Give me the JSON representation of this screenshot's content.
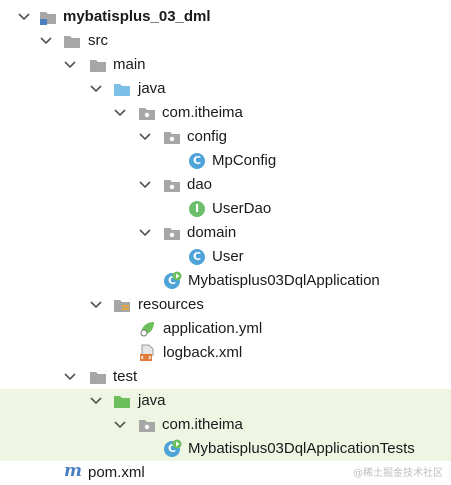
{
  "tree": {
    "items": [
      {
        "label": "mybatisplus_03_dml",
        "icon": "module-folder-icon",
        "expanded": true
      },
      {
        "label": "src",
        "icon": "folder-icon",
        "expanded": true
      },
      {
        "label": "main",
        "icon": "folder-icon",
        "expanded": true
      },
      {
        "label": "java",
        "icon": "source-root-folder-icon",
        "expanded": true
      },
      {
        "label": "com.itheima",
        "icon": "package-icon",
        "expanded": true
      },
      {
        "label": "config",
        "icon": "package-icon",
        "expanded": true
      },
      {
        "label": "MpConfig",
        "icon": "class-icon",
        "glyph": "C"
      },
      {
        "label": "dao",
        "icon": "package-icon",
        "expanded": true
      },
      {
        "label": "UserDao",
        "icon": "interface-icon",
        "glyph": "I"
      },
      {
        "label": "domain",
        "icon": "package-icon",
        "expanded": true
      },
      {
        "label": "User",
        "icon": "class-icon",
        "glyph": "C"
      },
      {
        "label": "Mybatisplus03DqlApplication",
        "icon": "spring-boot-class-icon",
        "glyph": "C"
      },
      {
        "label": "resources",
        "icon": "resources-folder-icon",
        "expanded": true
      },
      {
        "label": "application.yml",
        "icon": "spring-config-icon"
      },
      {
        "label": "logback.xml",
        "icon": "xml-file-icon"
      },
      {
        "label": "test",
        "icon": "folder-icon",
        "expanded": true
      },
      {
        "label": "java",
        "icon": "test-source-folder-icon",
        "expanded": true
      },
      {
        "label": "com.itheima",
        "icon": "package-icon",
        "expanded": true
      },
      {
        "label": "Mybatisplus03DqlApplicationTests",
        "icon": "test-class-icon",
        "glyph": "C"
      },
      {
        "label": "pom.xml",
        "icon": "maven-icon",
        "glyph": "m"
      }
    ]
  },
  "watermark": "@稀土掘金技术社区",
  "colors": {
    "test_highlight": "#eef6e3",
    "source_folder": "#7cc0e8",
    "test_folder": "#6cbf5a",
    "class_circle": "#4ea3d8",
    "interface_circle": "#6bbf6a",
    "folder_gray": "#a6a6a6"
  }
}
